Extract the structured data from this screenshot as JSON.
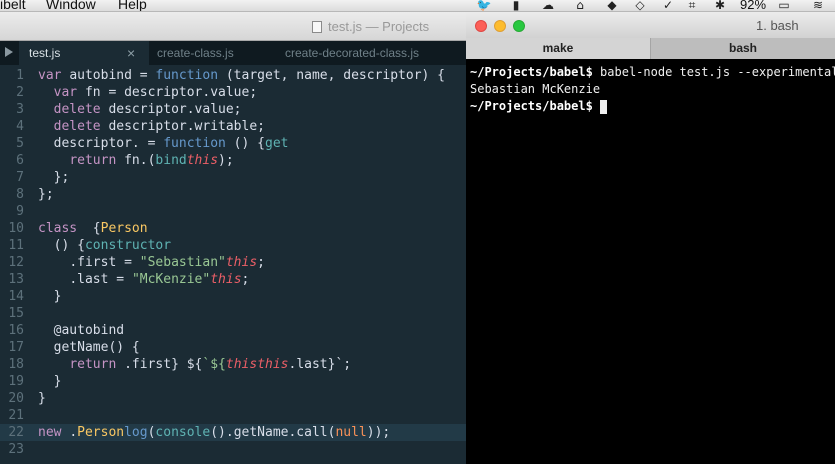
{
  "menubar": {
    "menu1": "ibelt",
    "menu2": "Window",
    "menu3": "Help",
    "battery": "92%",
    "icons": [
      "twitter-icon",
      "hat-icon",
      "cloud-icon",
      "dropbox-icon",
      "check-icon",
      "crop-icon",
      "bluetooth-icon",
      "battery-icon",
      "wifi-icon"
    ]
  },
  "editor": {
    "title": "test.js — Projects",
    "tabs": [
      "test.js",
      "create-class.js",
      "create-decorated-class.js"
    ],
    "close_glyph": "×",
    "line_numbers": [
      "1",
      "2",
      "3",
      "4",
      "5",
      "6",
      "7",
      "8",
      "9",
      "10",
      "11",
      "12",
      "13",
      "14",
      "15",
      "16",
      "17",
      "18",
      "19",
      "20",
      "21",
      "22",
      "23"
    ],
    "current_line": 22,
    "code": [
      {
        "t": "",
        "k": "var ",
        "a": "autobind = ",
        "f": "function",
        "b": " (target, name, descriptor) {"
      },
      {
        "t": "  ",
        "k": "var ",
        "a": "fn = descriptor.value;"
      },
      {
        "t": "  ",
        "k": "delete ",
        "a": "descriptor.value;"
      },
      {
        "t": "  ",
        "k": "delete ",
        "a": "descriptor.writable;"
      },
      {
        "t": "  descriptor.",
        "p": "get",
        "a": " = ",
        "f": "function",
        "b": " () {"
      },
      {
        "t": "    ",
        "k": "return ",
        "a": "fn.",
        "p": "bind",
        "b": "(",
        "th": "this",
        "e": ");"
      },
      {
        "t": "  };"
      },
      {
        "t": "};"
      },
      {
        "t": ""
      },
      {
        "t": "",
        "k": "class ",
        "c": "Person",
        "a": " {"
      },
      {
        "t": "  ",
        "p": "constructor",
        "a": "() {"
      },
      {
        "t": "    ",
        "th": "this",
        "a": ".first = ",
        "s": "\"Sebastian\"",
        "e": ";"
      },
      {
        "t": "    ",
        "th": "this",
        "a": ".last = ",
        "s": "\"McKenzie\"",
        "e": ";"
      },
      {
        "t": "  }"
      },
      {
        "t": ""
      },
      {
        "t": "  @autobind"
      },
      {
        "t": "  getName() {"
      },
      {
        "t": "    ",
        "k": "return ",
        "s": "`${",
        "th": "this",
        "a": ".first} ${",
        "th2": "this",
        "e": ".last}`;"
      },
      {
        "t": "  }"
      },
      {
        "t": "}"
      },
      {
        "t": ""
      },
      {
        "t": "",
        "p": "console",
        "a": ".",
        "f": "log",
        "b": "(",
        "k": "new ",
        "c": "Person",
        "e": "().getName.call(",
        "o": "null",
        "z": "));"
      },
      {
        "t": ""
      }
    ]
  },
  "terminal": {
    "title": "1. bash",
    "tabs": [
      "make",
      "bash"
    ],
    "prompt": "~/Projects/babel$",
    "command": " babel-node test.js --experimental",
    "output": "Sebastian McKenzie",
    "prompt2": "~/Projects/babel$"
  }
}
